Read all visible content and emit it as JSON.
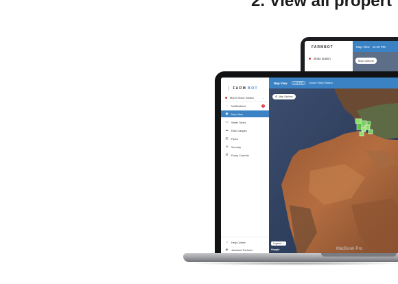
{
  "headline": "2. View all propert",
  "back_screen": {
    "logo": "FARMBOT",
    "station_label": "Moda Station",
    "topbar_title": "Map View",
    "topbar_time": "11:20 PM",
    "map_button": "Map Options"
  },
  "front_screen": {
    "logo_prefix": "FARM",
    "logo_suffix": "BOT",
    "station": "Mount Victor Station",
    "nav": [
      {
        "label": "Notifications",
        "icon": "bell-icon"
      },
      {
        "label": "Map View",
        "icon": "map-icon"
      },
      {
        "label": "Water Tanks",
        "icon": "tank-icon"
      },
      {
        "label": "Rain Gauges",
        "icon": "rain-icon"
      },
      {
        "label": "Pipes",
        "icon": "pipe-icon"
      },
      {
        "label": "Security",
        "icon": "security-icon"
      },
      {
        "label": "Pump Controls",
        "icon": "pump-icon"
      }
    ],
    "notifications_badge": "2",
    "help_label": "Help Centre",
    "partners_label": "Jamback Partners",
    "topbar_title": "Map View",
    "topbar_time": "1:20 PM",
    "topbar_station": "Mount Victor Station",
    "map_options": "Map Options",
    "legend": "Legend",
    "map_credit": "Google"
  },
  "device_brand": "MacBook Pro",
  "colors": {
    "accent_blue": "#3b82c4",
    "badge_red": "#d9363e",
    "bezel": "#111214"
  }
}
